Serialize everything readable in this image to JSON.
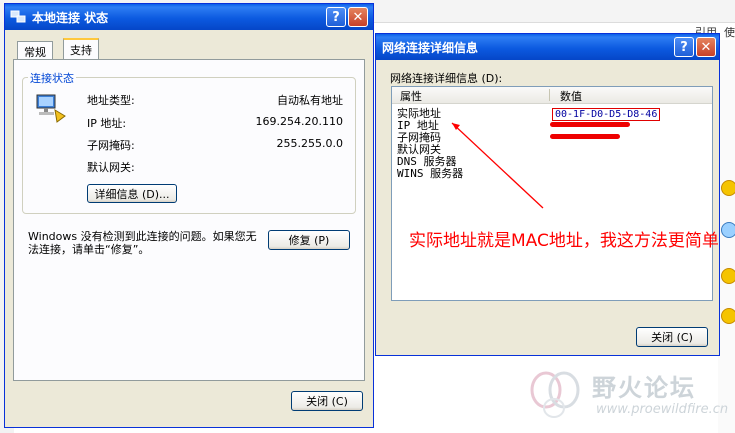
{
  "background": {
    "top_right_links": [
      "引用",
      "使"
    ]
  },
  "status_window": {
    "title": "本地连接 状态",
    "tabs": [
      {
        "label": "常规",
        "active": false
      },
      {
        "label": "支持",
        "active": true
      }
    ],
    "group_title": "连接状态",
    "fields": [
      {
        "label": "地址类型:",
        "value": "自动私有地址"
      },
      {
        "label": "IP 地址:",
        "value": "169.254.20.110"
      },
      {
        "label": "子网掩码:",
        "value": "255.255.0.0"
      },
      {
        "label": "默认网关:",
        "value": ""
      }
    ],
    "details_button": "详细信息 (D)...",
    "message": "Windows 没有检测到此连接的问题。如果您无法连接，请单击“修复”。",
    "repair_button": "修复 (P)",
    "close_button": "关闭 (C)"
  },
  "details_window": {
    "title": "网络连接详细信息",
    "list_label": "网络连接详细信息 (D):",
    "columns": [
      "属性",
      "数值"
    ],
    "rows": [
      {
        "property": "实际地址",
        "value": "00-1F-D0-D5-D8-46"
      },
      {
        "property": "IP 地址",
        "value": ""
      },
      {
        "property": "子网掩码",
        "value": ""
      },
      {
        "property": "默认网关",
        "value": ""
      },
      {
        "property": "DNS 服务器",
        "value": ""
      },
      {
        "property": "WINS 服务器",
        "value": ""
      }
    ],
    "annotation": "实际地址就是MAC地址，我这方法更简单",
    "close_button": "关闭 (C)"
  },
  "watermark": {
    "name": "野火论坛",
    "url": "www.proewildfire.cn"
  },
  "colors": {
    "title_blue": "#0a5fe8",
    "annotation_red": "#ff0000",
    "group_title_blue": "#0046d5"
  }
}
